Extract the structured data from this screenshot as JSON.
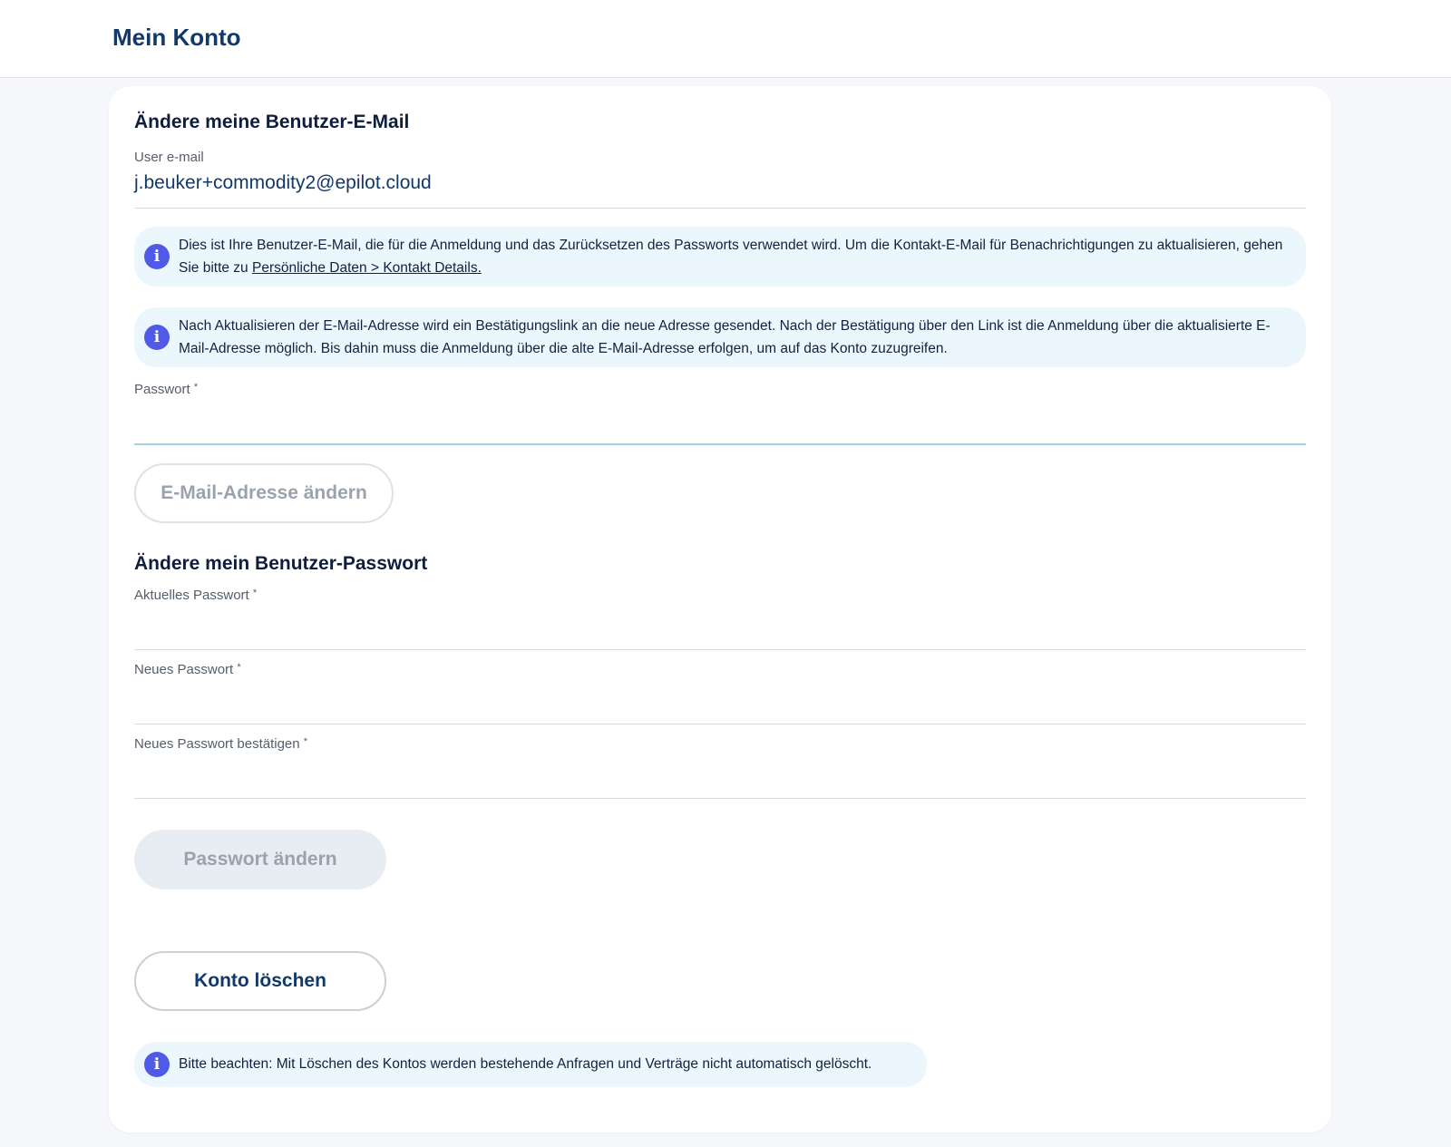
{
  "header": {
    "title": "Mein Konto"
  },
  "email_section": {
    "title": "Ändere meine Benutzer-E-Mail",
    "user_email_label": "User e-mail",
    "user_email_value": "j.beuker+commodity2@epilot.cloud",
    "info1_text": "Dies ist Ihre Benutzer-E-Mail, die für die Anmeldung und das Zurücksetzen des Passworts verwendet wird. Um die Kontakt-E-Mail für Benachrichtigungen zu aktualisieren, gehen Sie bitte zu ",
    "info1_link": "Persönliche Daten > Kontakt Details.",
    "info2_text": "Nach Aktualisieren der E-Mail-Adresse wird ein Bestätigungslink an die neue Adresse gesendet. Nach der Bestätigung über den Link ist die Anmeldung über die aktualisierte E-Mail-Adresse möglich. Bis dahin muss die Anmeldung über die alte E-Mail-Adresse erfolgen, um auf das Konto zuzugreifen.",
    "password_label": "Passwort",
    "required_mark": "*",
    "password_value": "",
    "change_email_button": "E-Mail-Adresse ändern"
  },
  "password_section": {
    "title": "Ändere mein Benutzer-Passwort",
    "current_label": "Aktuelles Passwort",
    "new_label": "Neues Passwort",
    "confirm_label": "Neues Passwort bestätigen",
    "required_mark": "*",
    "current_value": "",
    "new_value": "",
    "confirm_value": "",
    "change_password_button": "Passwort ändern"
  },
  "delete_section": {
    "delete_button": "Konto löschen",
    "info_text": "Bitte beachten: Mit Löschen des Kontos werden bestehende Anfragen und Verträge nicht automatisch gelöscht."
  },
  "icons": {
    "info": "info-icon"
  },
  "colors": {
    "brand_navy": "#13386b",
    "info_background": "#ecf6fd",
    "info_icon": "#4f5be6",
    "page_background": "#f5f7fa"
  }
}
